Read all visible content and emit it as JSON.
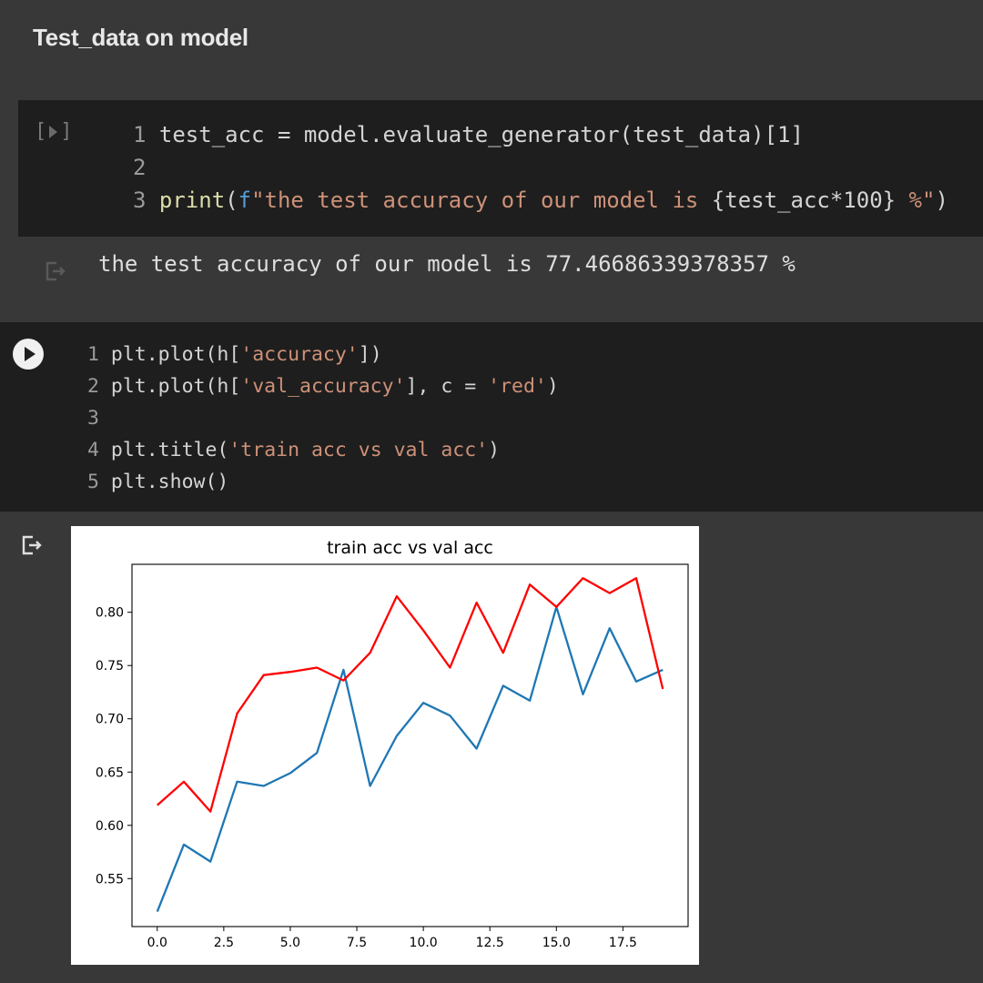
{
  "section": {
    "heading": "Test_data on model"
  },
  "cell1": {
    "run_status": "[ ]",
    "lines": [
      {
        "num": "1",
        "parts": [
          {
            "t": "test_acc = model.evaluate_generator(test_data)[1]",
            "c": "plain"
          }
        ]
      },
      {
        "num": "2",
        "parts": []
      },
      {
        "num": "3",
        "parts": [
          {
            "t": "print",
            "c": "kw"
          },
          {
            "t": "(",
            "c": "plain"
          },
          {
            "t": "f",
            "c": "fstr"
          },
          {
            "t": "\"the test accuracy of our model is ",
            "c": "str"
          },
          {
            "t": "{test_acc*100}",
            "c": "plain"
          },
          {
            "t": " %\"",
            "c": "str"
          },
          {
            "t": ")",
            "c": "plain"
          }
        ]
      }
    ],
    "output": "the test accuracy of our model is 77.46686339378357 %"
  },
  "cell2": {
    "lines": [
      {
        "num": "1",
        "parts": [
          {
            "t": "plt.plot(h[",
            "c": "plain"
          },
          {
            "t": "'accuracy'",
            "c": "str"
          },
          {
            "t": "])",
            "c": "plain"
          }
        ]
      },
      {
        "num": "2",
        "parts": [
          {
            "t": "plt.plot(h[",
            "c": "plain"
          },
          {
            "t": "'val_accuracy'",
            "c": "str"
          },
          {
            "t": "], c = ",
            "c": "plain"
          },
          {
            "t": "'red'",
            "c": "str"
          },
          {
            "t": ")",
            "c": "plain"
          }
        ]
      },
      {
        "num": "3",
        "parts": []
      },
      {
        "num": "4",
        "parts": [
          {
            "t": "plt.title(",
            "c": "plain"
          },
          {
            "t": "'train acc vs val acc'",
            "c": "str"
          },
          {
            "t": ")",
            "c": "plain"
          }
        ]
      },
      {
        "num": "5",
        "parts": [
          {
            "t": "plt.show()",
            "c": "plain"
          }
        ]
      }
    ]
  },
  "icons": {
    "run_button": "play-icon",
    "output": "output-arrow-icon"
  },
  "chart_data": {
    "type": "line",
    "title": "train acc vs val acc",
    "x": [
      0,
      1,
      2,
      3,
      4,
      5,
      6,
      7,
      8,
      9,
      10,
      11,
      12,
      13,
      14,
      15,
      16,
      17,
      18,
      19
    ],
    "xlim": [
      -0.95,
      19.95
    ],
    "ylim": [
      0.505,
      0.845
    ],
    "xticks": [
      0.0,
      2.5,
      5.0,
      7.5,
      10.0,
      12.5,
      15.0,
      17.5
    ],
    "xtick_labels": [
      "0.0",
      "2.5",
      "5.0",
      "7.5",
      "10.0",
      "12.5",
      "15.0",
      "17.5"
    ],
    "yticks": [
      0.55,
      0.6,
      0.65,
      0.7,
      0.75,
      0.8
    ],
    "ytick_labels": [
      "0.55",
      "0.60",
      "0.65",
      "0.70",
      "0.75",
      "0.80"
    ],
    "grid": false,
    "series": [
      {
        "color": "#1f77b4",
        "values": [
          0.519,
          0.582,
          0.566,
          0.641,
          0.637,
          0.649,
          0.668,
          0.746,
          0.637,
          0.684,
          0.715,
          0.703,
          0.672,
          0.731,
          0.717,
          0.805,
          0.723,
          0.785,
          0.735,
          0.746
        ]
      },
      {
        "color": "#ff0000",
        "values": [
          0.619,
          0.641,
          0.613,
          0.705,
          0.741,
          0.744,
          0.748,
          0.736,
          0.762,
          0.815,
          0.783,
          0.748,
          0.809,
          0.762,
          0.826,
          0.805,
          0.832,
          0.818,
          0.832,
          0.728
        ]
      }
    ]
  }
}
